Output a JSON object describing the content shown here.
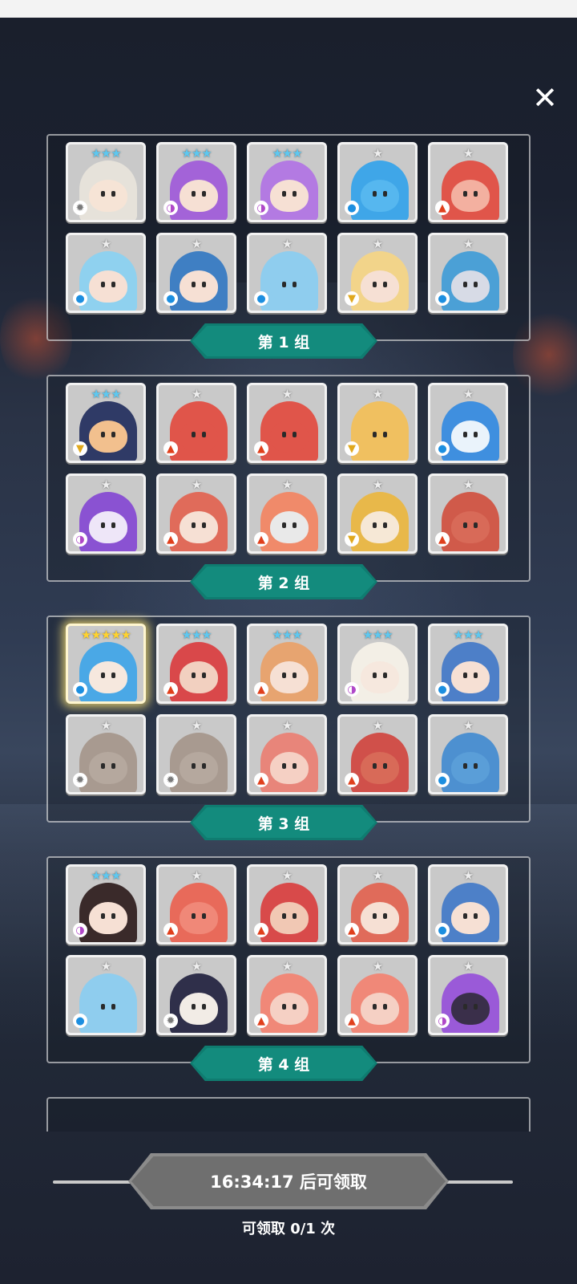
{
  "close_icon": "close-icon",
  "groups": [
    {
      "label": "第 1 组",
      "heroes": [
        {
          "stars": "★★★",
          "star_color": "blue",
          "element": "light",
          "element_glyph": "✹",
          "hair": "#e6e2da",
          "skin": "#f6e4d6"
        },
        {
          "stars": "★★★",
          "star_color": "blue",
          "element": "dark",
          "element_glyph": "◑",
          "hair": "#a363d8",
          "skin": "#f6e0d4"
        },
        {
          "stars": "★★★",
          "star_color": "blue",
          "element": "dark",
          "element_glyph": "◑",
          "hair": "#b37ae2",
          "skin": "#f6e0d4"
        },
        {
          "stars": "★",
          "star_color": "silver",
          "element": "water",
          "element_glyph": "●",
          "hair": "#3fa6e8",
          "skin": "#56b7ef"
        },
        {
          "stars": "★",
          "star_color": "silver",
          "element": "fire",
          "element_glyph": "▲",
          "hair": "#e0554a",
          "skin": "#f3b0a0"
        },
        {
          "stars": "★",
          "star_color": "silver",
          "element": "water",
          "element_glyph": "●",
          "hair": "#8fd1ef",
          "skin": "#f6e0d4"
        },
        {
          "stars": "★",
          "star_color": "silver",
          "element": "water",
          "element_glyph": "●",
          "hair": "#3f7fc3",
          "skin": "#f6e0d4"
        },
        {
          "stars": "★",
          "star_color": "silver",
          "element": "water",
          "element_glyph": "●",
          "hair": "#8fcdee",
          "skin": "#8fcdee"
        },
        {
          "stars": "★",
          "star_color": "silver",
          "element": "thunder",
          "element_glyph": "▼",
          "hair": "#f2d48a",
          "skin": "#f6e0d4"
        },
        {
          "stars": "★",
          "star_color": "silver",
          "element": "water",
          "element_glyph": "●",
          "hair": "#4ba0d6",
          "skin": "#d7dbe6"
        }
      ]
    },
    {
      "label": "第 2 组",
      "heroes": [
        {
          "stars": "★★★",
          "star_color": "blue",
          "element": "thunder",
          "element_glyph": "▼",
          "hair": "#2f3a66",
          "skin": "#f2c08e"
        },
        {
          "stars": "★",
          "star_color": "silver",
          "element": "fire",
          "element_glyph": "▲",
          "hair": "#e0554a",
          "skin": "#e0554a"
        },
        {
          "stars": "★",
          "star_color": "silver",
          "element": "fire",
          "element_glyph": "▲",
          "hair": "#e0554a",
          "skin": "#e0554a"
        },
        {
          "stars": "★",
          "star_color": "silver",
          "element": "thunder",
          "element_glyph": "▼",
          "hair": "#f0c060",
          "skin": "#f0c060"
        },
        {
          "stars": "★",
          "star_color": "silver",
          "element": "water",
          "element_glyph": "●",
          "hair": "#3f8fdf",
          "skin": "#eaf3fb"
        },
        {
          "stars": "★",
          "star_color": "silver",
          "element": "dark",
          "element_glyph": "◑",
          "hair": "#8a52d2",
          "skin": "#eee6f8"
        },
        {
          "stars": "★",
          "star_color": "silver",
          "element": "fire",
          "element_glyph": "▲",
          "hair": "#e06b5a",
          "skin": "#f6e0d4"
        },
        {
          "stars": "★",
          "star_color": "silver",
          "element": "fire",
          "element_glyph": "▲",
          "hair": "#f08a6a",
          "skin": "#e9e9e9"
        },
        {
          "stars": "★",
          "star_color": "silver",
          "element": "thunder",
          "element_glyph": "▼",
          "hair": "#e8b84a",
          "skin": "#f6e8d6"
        },
        {
          "stars": "★",
          "star_color": "silver",
          "element": "fire",
          "element_glyph": "▲",
          "hair": "#d05a4a",
          "skin": "#d86a58"
        }
      ]
    },
    {
      "label": "第 3 组",
      "heroes": [
        {
          "stars": "★★★★★",
          "star_color": "gold",
          "element": "water",
          "element_glyph": "●",
          "hair": "#4aa8e6",
          "skin": "#f6e8de",
          "glow": true
        },
        {
          "stars": "★★★",
          "star_color": "blue",
          "element": "fire",
          "element_glyph": "▲",
          "hair": "#d9484a",
          "skin": "#f2d0c0"
        },
        {
          "stars": "★★★",
          "star_color": "blue",
          "element": "fire",
          "element_glyph": "▲",
          "hair": "#e7a470",
          "skin": "#f6e0d4"
        },
        {
          "stars": "★★★",
          "star_color": "blue",
          "element": "dark",
          "element_glyph": "◑",
          "hair": "#f3efe6",
          "skin": "#f6e8de"
        },
        {
          "stars": "★★★",
          "star_color": "blue",
          "element": "water",
          "element_glyph": "●",
          "hair": "#4d7fc8",
          "skin": "#f6e0d4"
        },
        {
          "stars": "★",
          "star_color": "silver",
          "element": "light",
          "element_glyph": "✹",
          "hair": "#a89a90",
          "skin": "#b5a89e"
        },
        {
          "stars": "★",
          "star_color": "silver",
          "element": "light",
          "element_glyph": "✹",
          "hair": "#a89a90",
          "skin": "#b5a89e"
        },
        {
          "stars": "★",
          "star_color": "silver",
          "element": "fire",
          "element_glyph": "▲",
          "hair": "#e8857a",
          "skin": "#f5d0c4"
        },
        {
          "stars": "★",
          "star_color": "silver",
          "element": "fire",
          "element_glyph": "▲",
          "hair": "#d0504a",
          "skin": "#d86a58"
        },
        {
          "stars": "★",
          "star_color": "silver",
          "element": "water",
          "element_glyph": "●",
          "hair": "#4d90d0",
          "skin": "#5a9ed8"
        }
      ]
    },
    {
      "label": "第 4 组",
      "heroes": [
        {
          "stars": "★★★",
          "star_color": "blue",
          "element": "dark",
          "element_glyph": "◑",
          "hair": "#3a2a2a",
          "skin": "#f6e0d4"
        },
        {
          "stars": "★",
          "star_color": "silver",
          "element": "fire",
          "element_glyph": "▲",
          "hair": "#e86a5a",
          "skin": "#f08878"
        },
        {
          "stars": "★",
          "star_color": "silver",
          "element": "fire",
          "element_glyph": "▲",
          "hair": "#d84a4a",
          "skin": "#f1c8b4"
        },
        {
          "stars": "★",
          "star_color": "silver",
          "element": "fire",
          "element_glyph": "▲",
          "hair": "#e06b5a",
          "skin": "#f6e0d4"
        },
        {
          "stars": "★",
          "star_color": "silver",
          "element": "water",
          "element_glyph": "●",
          "hair": "#4d80c8",
          "skin": "#f6e0d4"
        },
        {
          "stars": "★",
          "star_color": "silver",
          "element": "water",
          "element_glyph": "●",
          "hair": "#8fcdee",
          "skin": "#8fcdee"
        },
        {
          "stars": "★",
          "star_color": "silver",
          "element": "light",
          "element_glyph": "✹",
          "hair": "#2f2f4a",
          "skin": "#f2ece6"
        },
        {
          "stars": "★",
          "star_color": "silver",
          "element": "fire",
          "element_glyph": "▲",
          "hair": "#f08878",
          "skin": "#f5d0c4"
        },
        {
          "stars": "★",
          "star_color": "silver",
          "element": "fire",
          "element_glyph": "▲",
          "hair": "#f08878",
          "skin": "#f5d0c4"
        },
        {
          "stars": "★",
          "star_color": "silver",
          "element": "dark",
          "element_glyph": "◑",
          "hair": "#9a5ad8",
          "skin": "#3a2f4a"
        }
      ]
    }
  ],
  "footer": {
    "claim_button_label": "16:34:17 后可领取",
    "claim_count_label": "可领取 0/1 次"
  },
  "colors": {
    "banner": "#138b7d",
    "claim_button": "#6f6f6f",
    "card": "#c9c9c9"
  }
}
